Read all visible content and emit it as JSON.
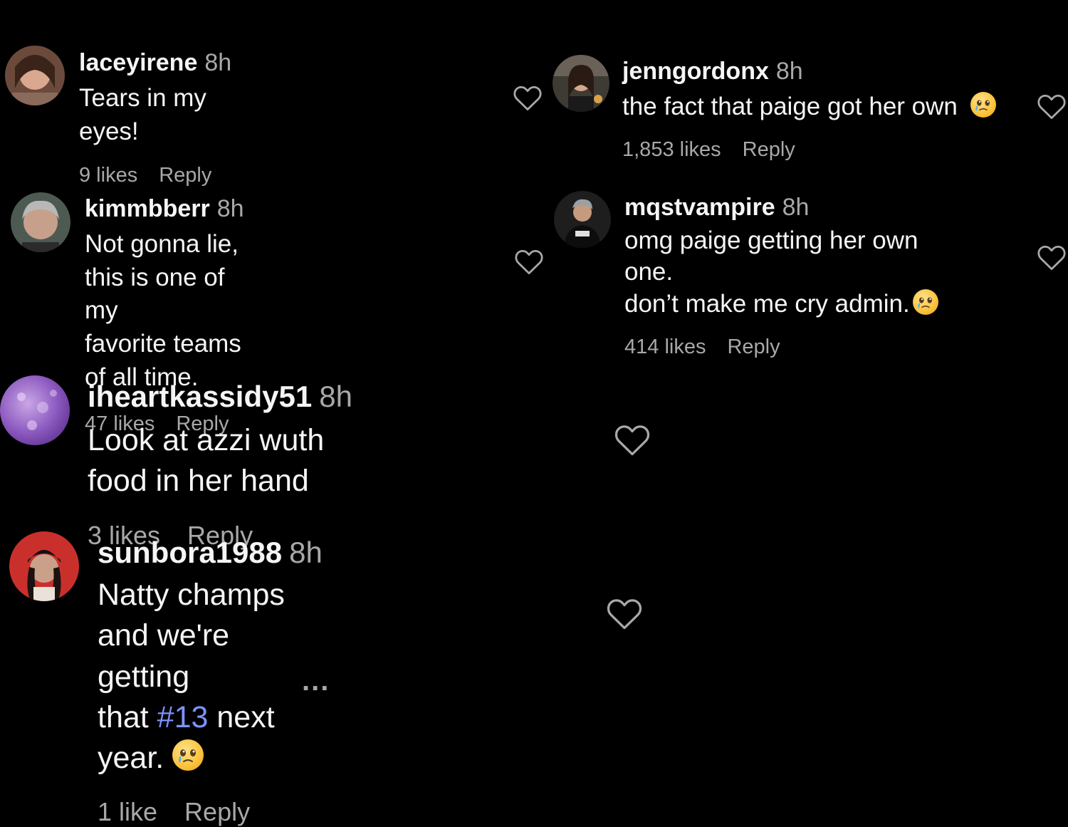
{
  "comments": [
    {
      "username": "laceyirene",
      "time": "8h",
      "text": "Tears in my eyes!",
      "likes": "9 likes",
      "reply": "Reply"
    },
    {
      "username": "kimmbberr",
      "time": "8h",
      "text_line1": "Not gonna lie, this is one of my",
      "text_line2": "favorite teams of all time.",
      "likes": "47 likes",
      "reply": "Reply"
    },
    {
      "username": "iheartkassidy51",
      "time": "8h",
      "text": "Look at azzi wuth food in her hand",
      "likes": "3 likes",
      "reply": "Reply"
    },
    {
      "username": "sunbora1988",
      "time": "8h",
      "text_line1": "Natty champs and we're getting",
      "text_line2_before": "that ",
      "hashtag": "#13",
      "text_line2_after": " next year. ",
      "likes": "1 like",
      "reply": "Reply",
      "more": "..."
    },
    {
      "username": "jenngordonx",
      "time": "8h",
      "text": "the fact that paige got her own ",
      "likes": "1,853 likes",
      "reply": "Reply"
    },
    {
      "username": "mqstvampire",
      "time": "8h",
      "text_line1": "omg paige getting her own one.",
      "text_line2": "don’t make me cry admin.",
      "likes": "414 likes",
      "reply": "Reply"
    }
  ],
  "icons": {
    "heart": "heart-outline-icon",
    "emoji": "crying-face-emoji-icon",
    "more": "more-dots-icon"
  },
  "colors": {
    "background": "#000000",
    "primary_text": "#f5f5f5",
    "secondary_text": "#a8a8a8",
    "hashtag": "#7c93ff"
  }
}
